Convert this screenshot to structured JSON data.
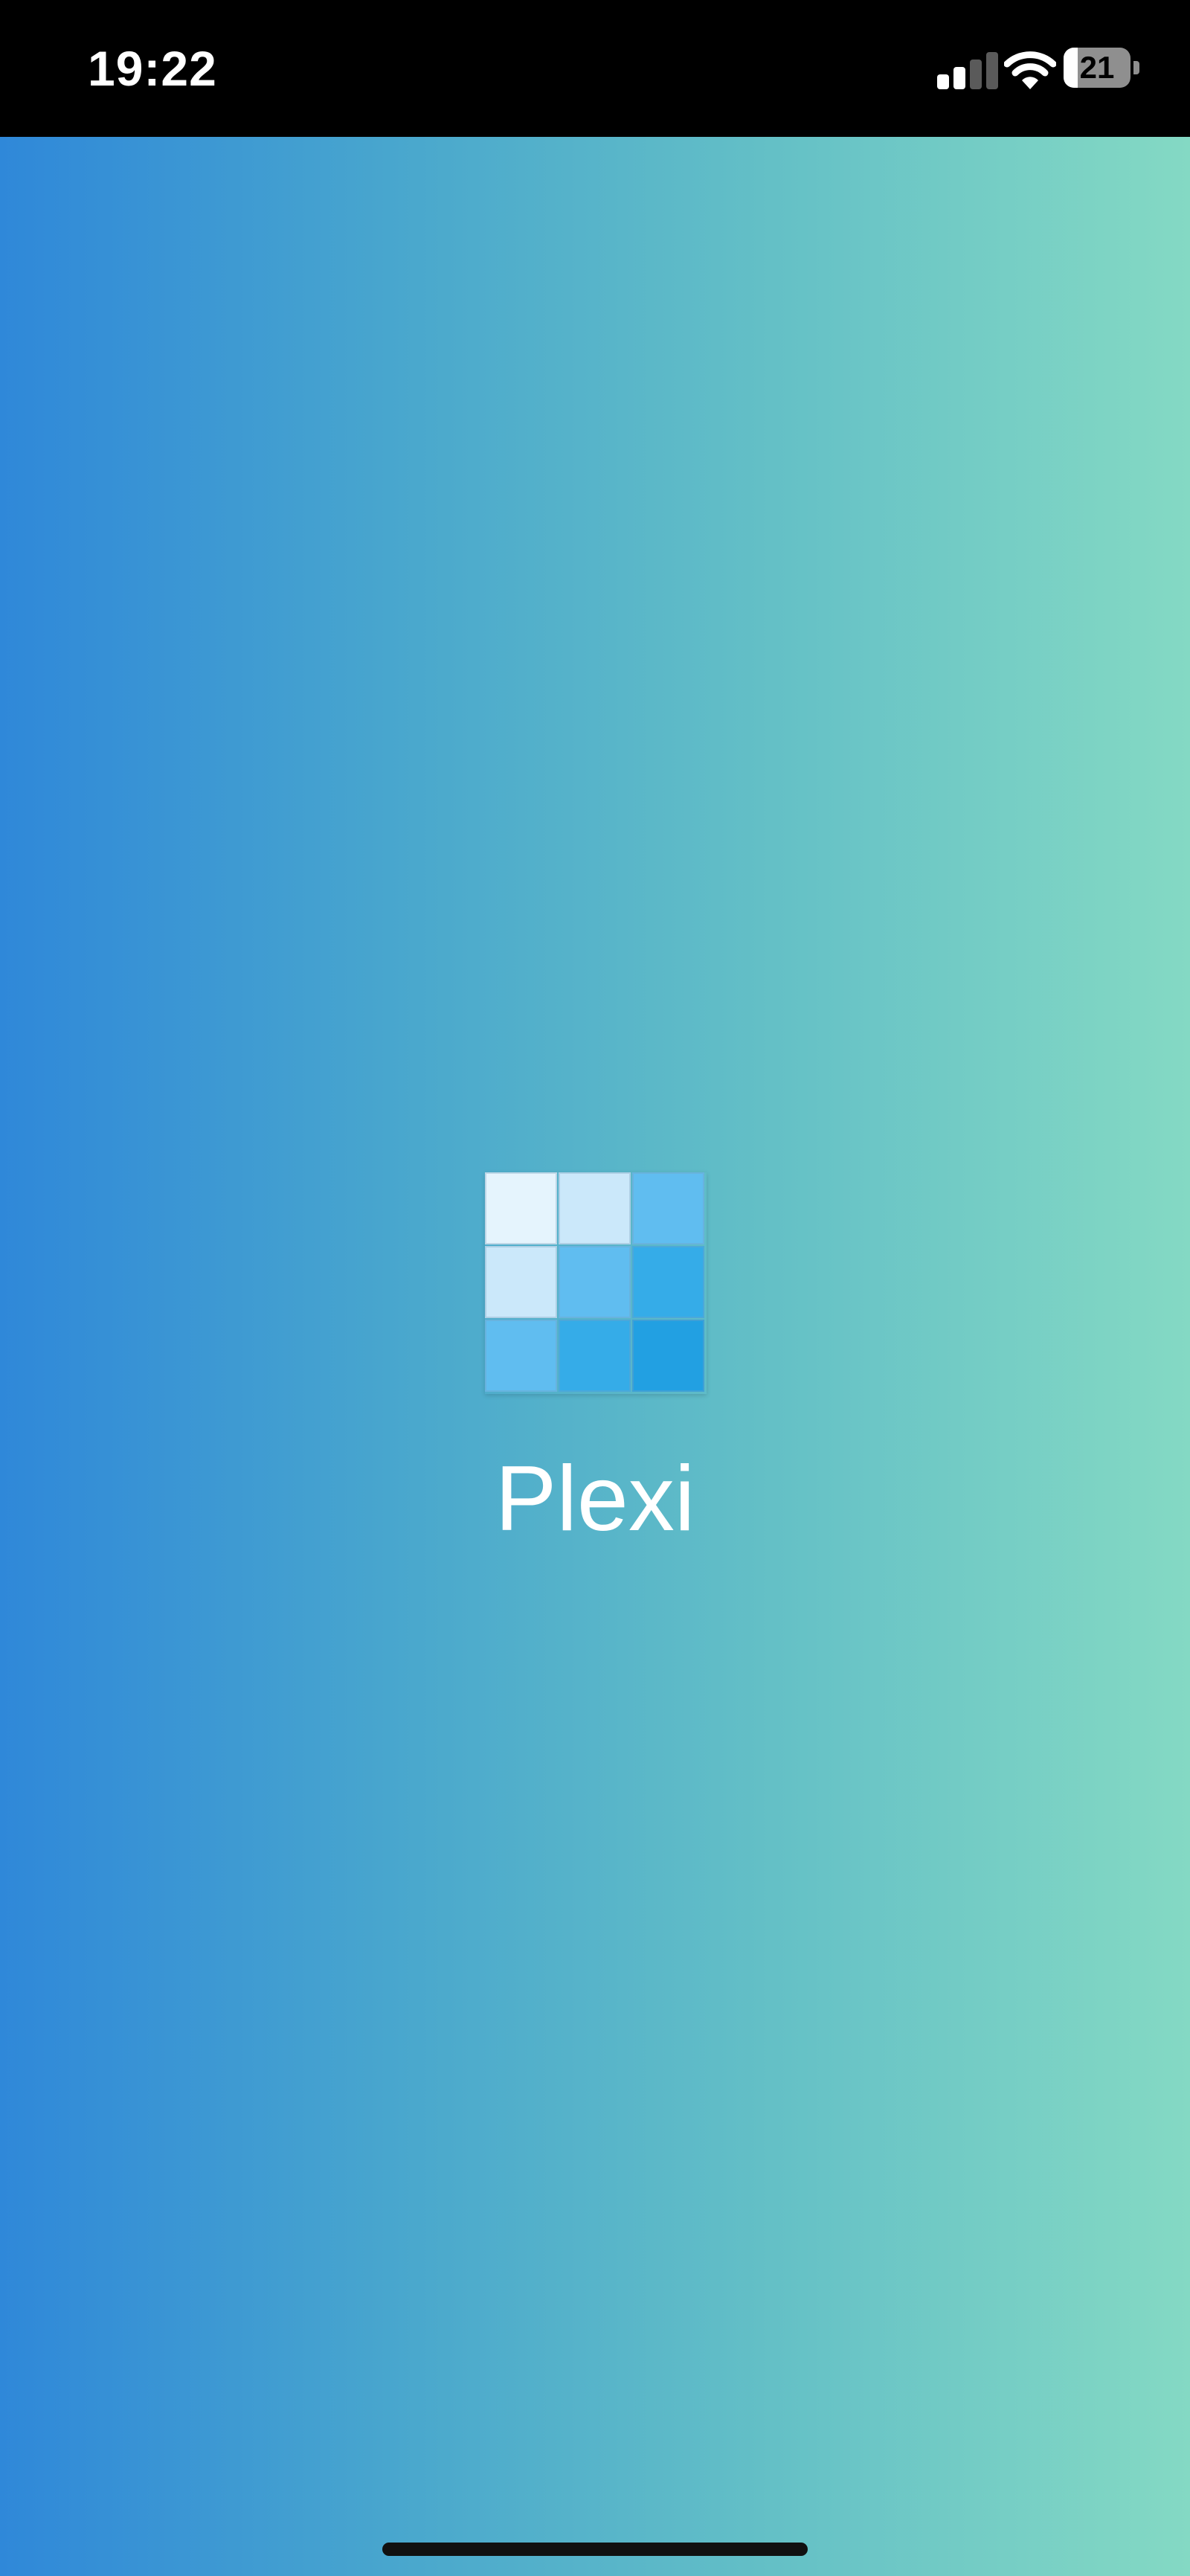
{
  "status_bar": {
    "time": "19:22",
    "battery_level": "21",
    "battery_fraction": 0.21,
    "signal_bars_active": 2,
    "signal_bars_total": 4,
    "icons": [
      "cellular-signal-icon",
      "wifi-icon",
      "battery-icon"
    ]
  },
  "splash": {
    "app_name": "Plexi",
    "logo_icon": "plexi-grid-logo",
    "logo_colors": [
      [
        "#e5f4fd",
        "#cbe8fa",
        "#60bdf0"
      ],
      [
        "#cbe8fa",
        "#60bdf0",
        "#35ace8"
      ],
      [
        "#60bdf0",
        "#35ace8",
        "#22a0e2"
      ]
    ]
  },
  "colors": {
    "gradient_start": "#2f88d9",
    "gradient_end": "#84d9c4",
    "status_bar_bg": "#000000",
    "text": "#ffffff"
  }
}
